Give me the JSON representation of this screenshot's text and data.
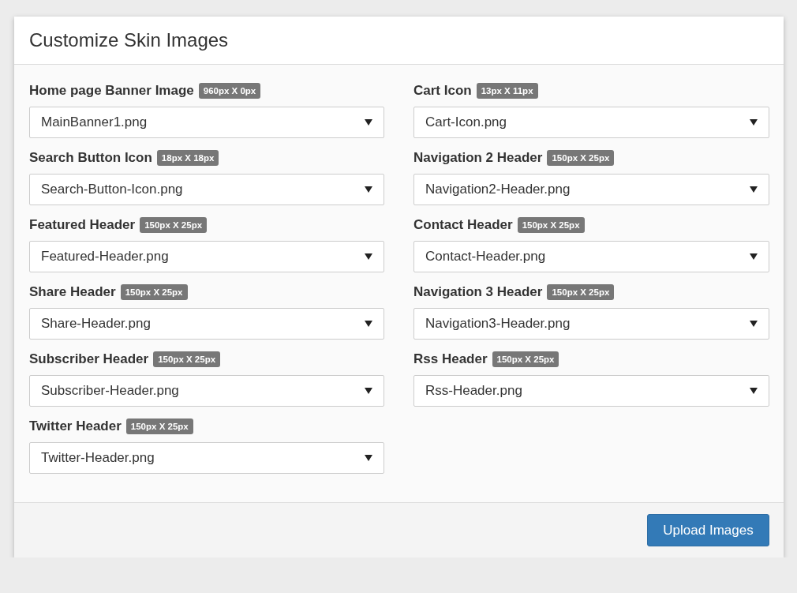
{
  "panel": {
    "title": "Customize Skin Images"
  },
  "fields": [
    {
      "label": "Home page Banner Image",
      "badge": "960px X 0px",
      "value": "MainBanner1.png"
    },
    {
      "label": "Cart Icon",
      "badge": "13px X 11px",
      "value": "Cart-Icon.png"
    },
    {
      "label": "Search Button Icon",
      "badge": "18px X 18px",
      "value": "Search-Button-Icon.png"
    },
    {
      "label": "Navigation 2 Header",
      "badge": "150px X 25px",
      "value": "Navigation2-Header.png"
    },
    {
      "label": "Featured Header",
      "badge": "150px X 25px",
      "value": "Featured-Header.png"
    },
    {
      "label": "Contact Header",
      "badge": "150px X 25px",
      "value": "Contact-Header.png"
    },
    {
      "label": "Share Header",
      "badge": "150px X 25px",
      "value": "Share-Header.png"
    },
    {
      "label": "Navigation 3 Header",
      "badge": "150px X 25px",
      "value": "Navigation3-Header.png"
    },
    {
      "label": "Subscriber Header",
      "badge": "150px X 25px",
      "value": "Subscriber-Header.png"
    },
    {
      "label": "Rss Header",
      "badge": "150px X 25px",
      "value": "Rss-Header.png"
    },
    {
      "label": "Twitter Header",
      "badge": "150px X 25px",
      "value": "Twitter-Header.png"
    }
  ],
  "footer": {
    "button": "Upload Images"
  }
}
